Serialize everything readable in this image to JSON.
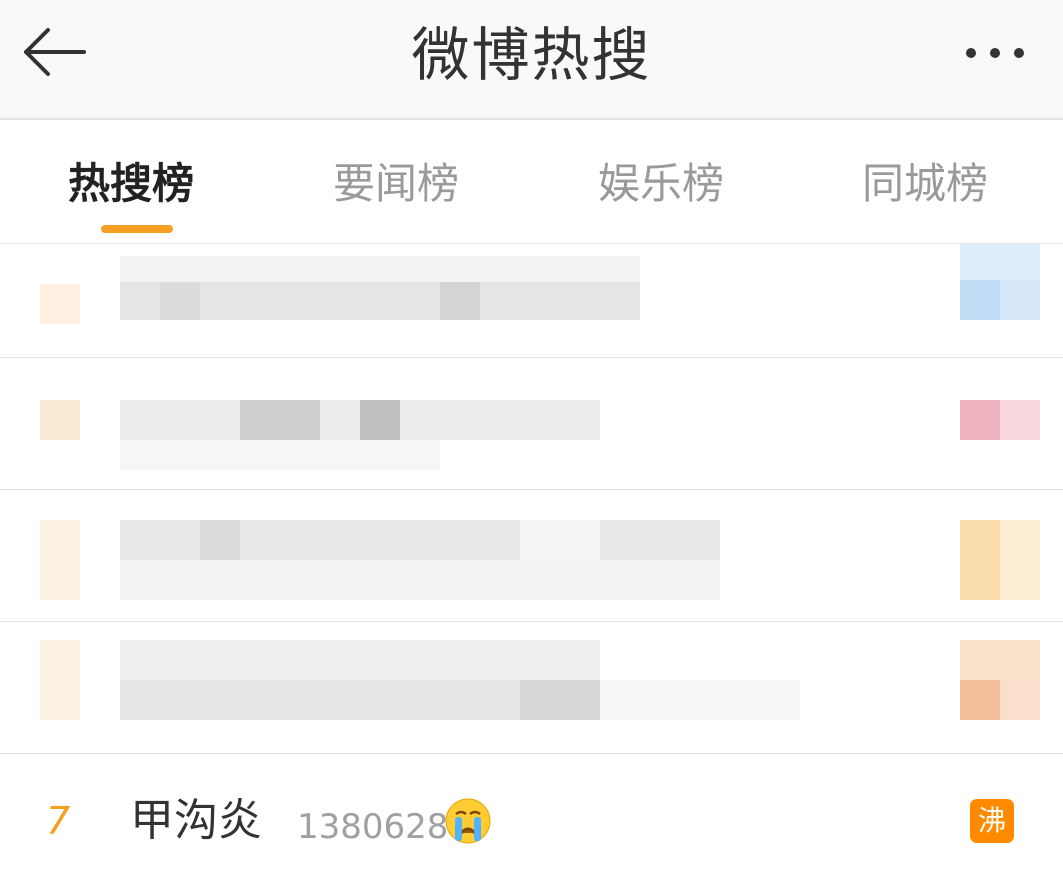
{
  "header": {
    "title": "微博热搜",
    "back_icon": "arrow-left-icon",
    "more_icon": "more-dots-icon"
  },
  "tabs": [
    {
      "label": "热搜榜",
      "active": true
    },
    {
      "label": "要闻榜",
      "active": false
    },
    {
      "label": "娱乐榜",
      "active": false
    },
    {
      "label": "同城榜",
      "active": false
    }
  ],
  "colors": {
    "accent": "#f5a020",
    "hot_badge": "#ff8a00"
  },
  "list": {
    "visible_item": {
      "rank": "7",
      "topic": "甲沟炎",
      "count": "1380628",
      "emoji_icon": "crying-face-emoji-icon",
      "badge": "沸"
    }
  }
}
